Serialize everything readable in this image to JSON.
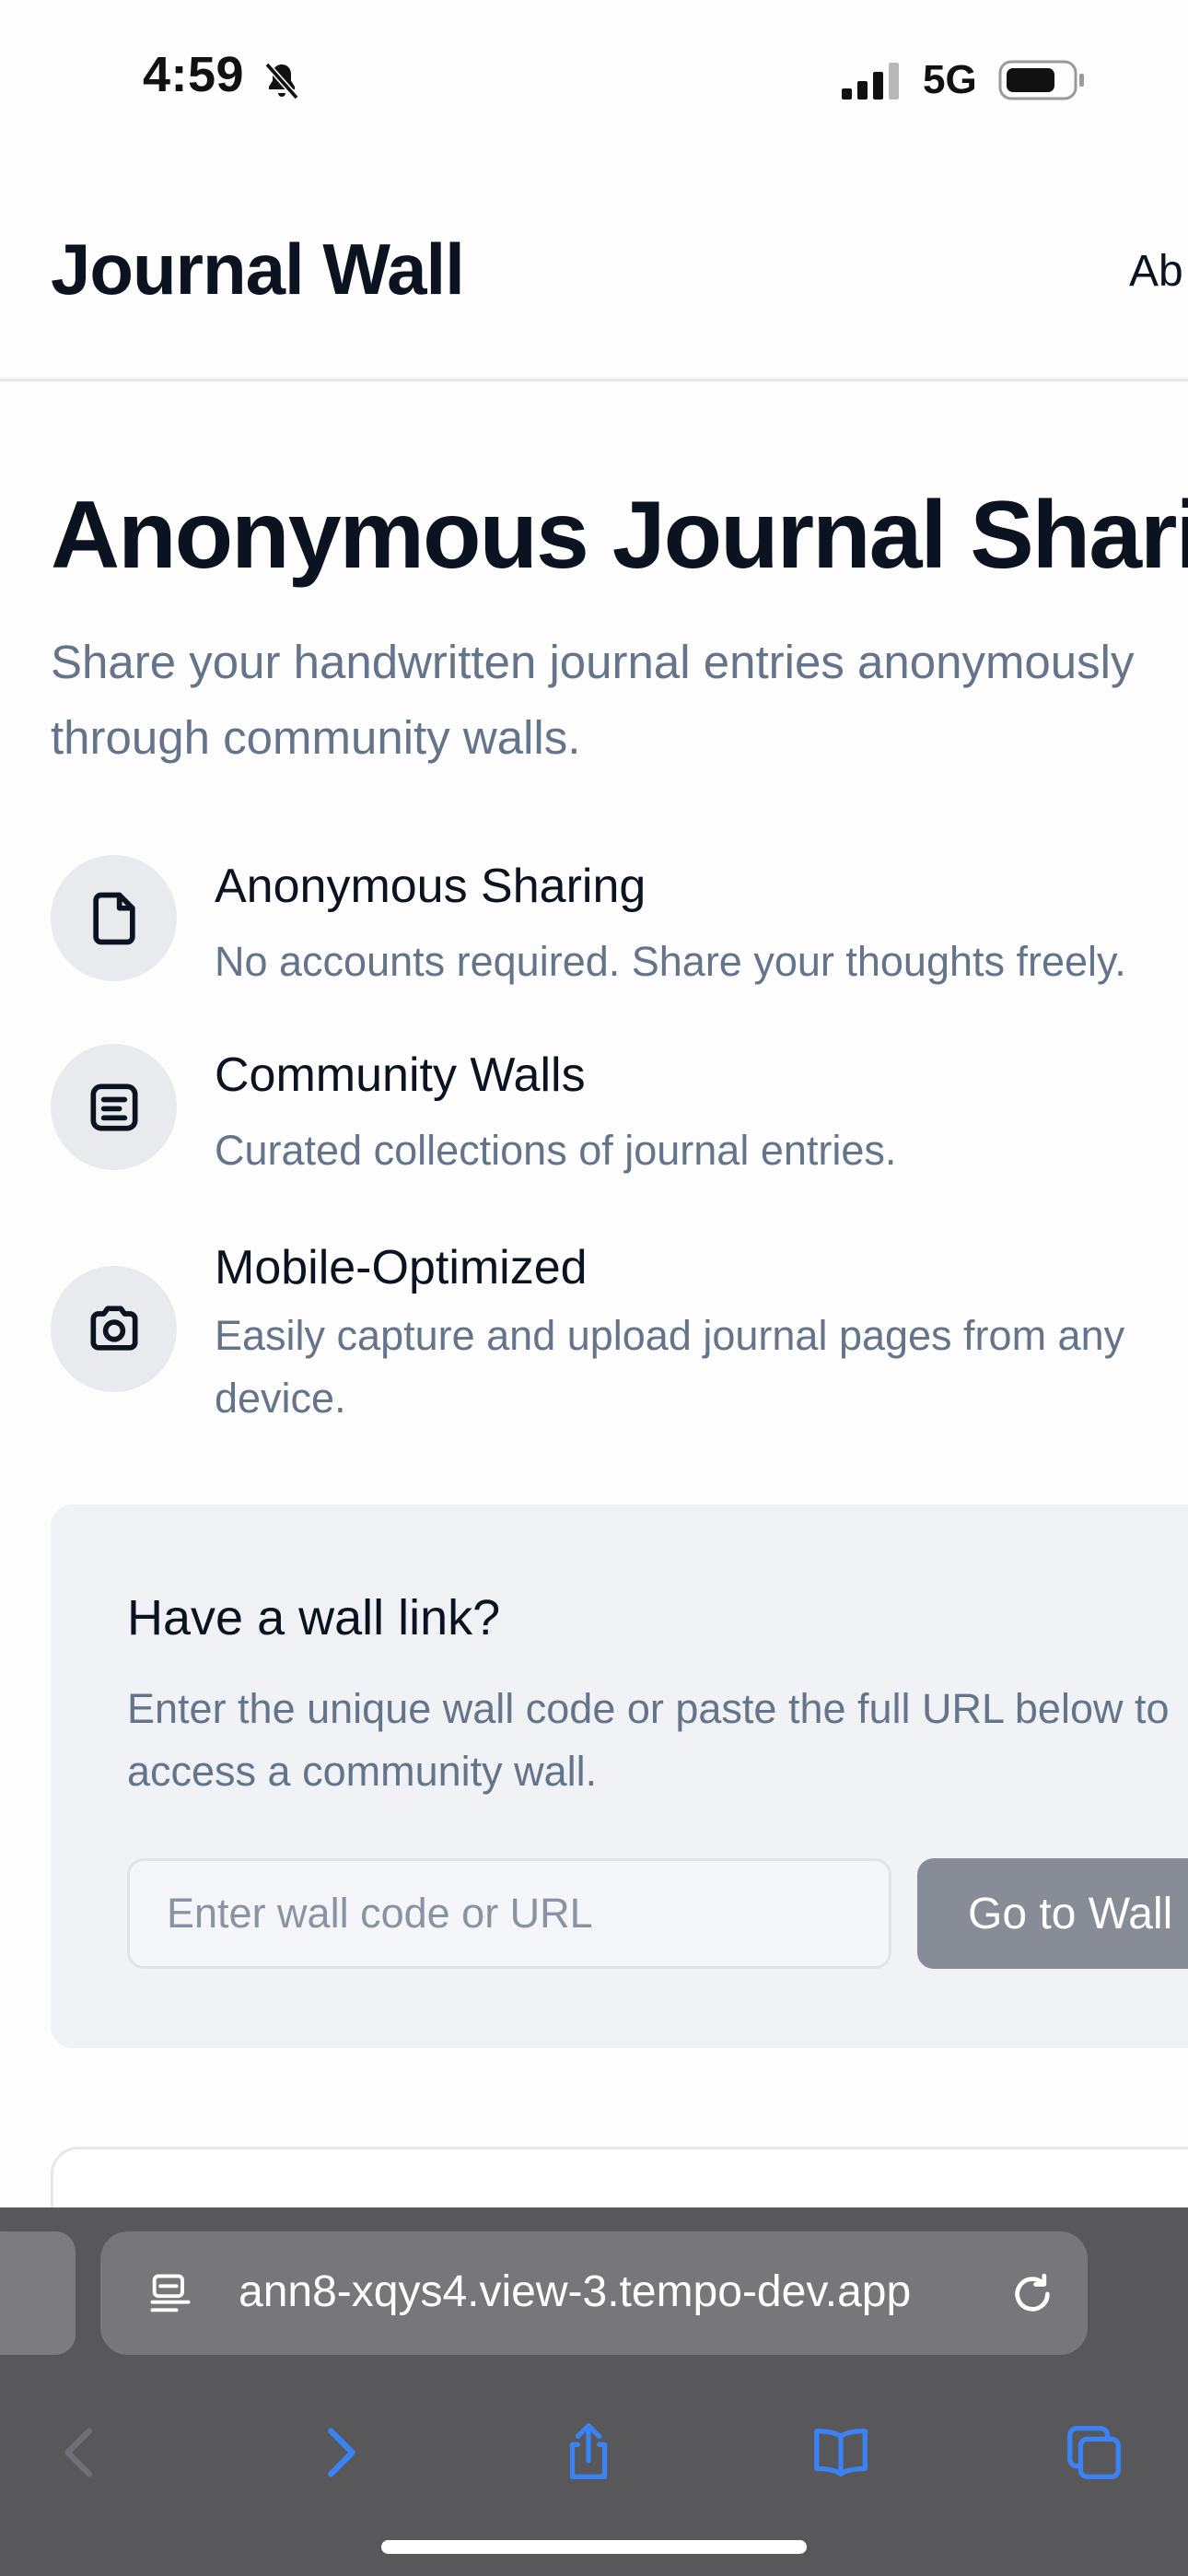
{
  "status_bar": {
    "time": "4:59",
    "network": "5G",
    "icons": [
      "bell-slash-icon",
      "signal-icon",
      "battery-icon"
    ]
  },
  "header": {
    "title": "Journal Wall",
    "nav_about": "Ab"
  },
  "hero": {
    "title": "Anonymous Journal Sharing",
    "subtitle": "Share your handwritten journal entries anonymously through community walls."
  },
  "features": [
    {
      "icon": "file-icon",
      "title": "Anonymous Sharing",
      "description": "No accounts required. Share your thoughts freely."
    },
    {
      "icon": "list-icon",
      "title": "Community Walls",
      "description": "Curated collections of journal entries."
    },
    {
      "icon": "camera-icon",
      "title": "Mobile-Optimized",
      "description": "Easily capture and upload journal pages from any device."
    }
  ],
  "wall_link": {
    "title": "Have a wall link?",
    "description": "Enter the unique wall code or paste the full URL below to access a community wall.",
    "input_placeholder": "Enter wall code or URL",
    "input_value": "",
    "button_label": "Go to Wall"
  },
  "browser": {
    "url": "ann8-xqys4.view-3.tempo-dev.app",
    "toolbar_icons": [
      "back-icon",
      "forward-icon",
      "share-icon",
      "bookmarks-icon",
      "tabs-icon"
    ]
  },
  "colors": {
    "accent": "#3b82f6",
    "text_primary": "#0b1220",
    "text_muted": "#64748b",
    "button_disabled": "#878c96",
    "browser_bar": "#58585b"
  }
}
